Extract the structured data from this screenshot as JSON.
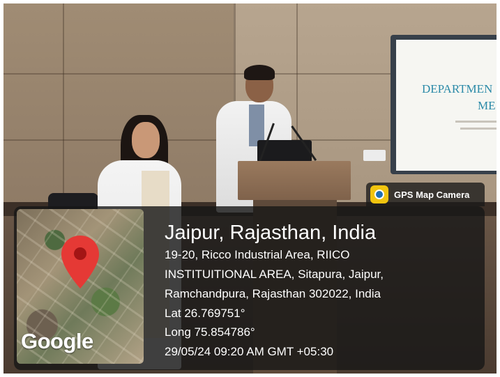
{
  "screen": {
    "title_line1": "DEPARTMEN",
    "title_line2": "ME"
  },
  "gps_badge": {
    "app_name": "GPS Map Camera",
    "icon": "camera-lens-icon"
  },
  "map": {
    "logo_text": "Google",
    "pin_icon": "map-pin-icon",
    "pin_color": "#e53935"
  },
  "location": {
    "title": "Jaipur, Rajasthan, India",
    "address_line1": "19-20, Ricco Industrial Area, RIICO",
    "address_line2": "INSTITUITIONAL AREA, Sitapura, Jaipur,",
    "address_line3": "Ramchandpura, Rajasthan 302022, India",
    "latitude": "Lat 26.769751°",
    "longitude": "Long 75.854786°",
    "timestamp": "29/05/24 09:20 AM GMT +05:30"
  }
}
